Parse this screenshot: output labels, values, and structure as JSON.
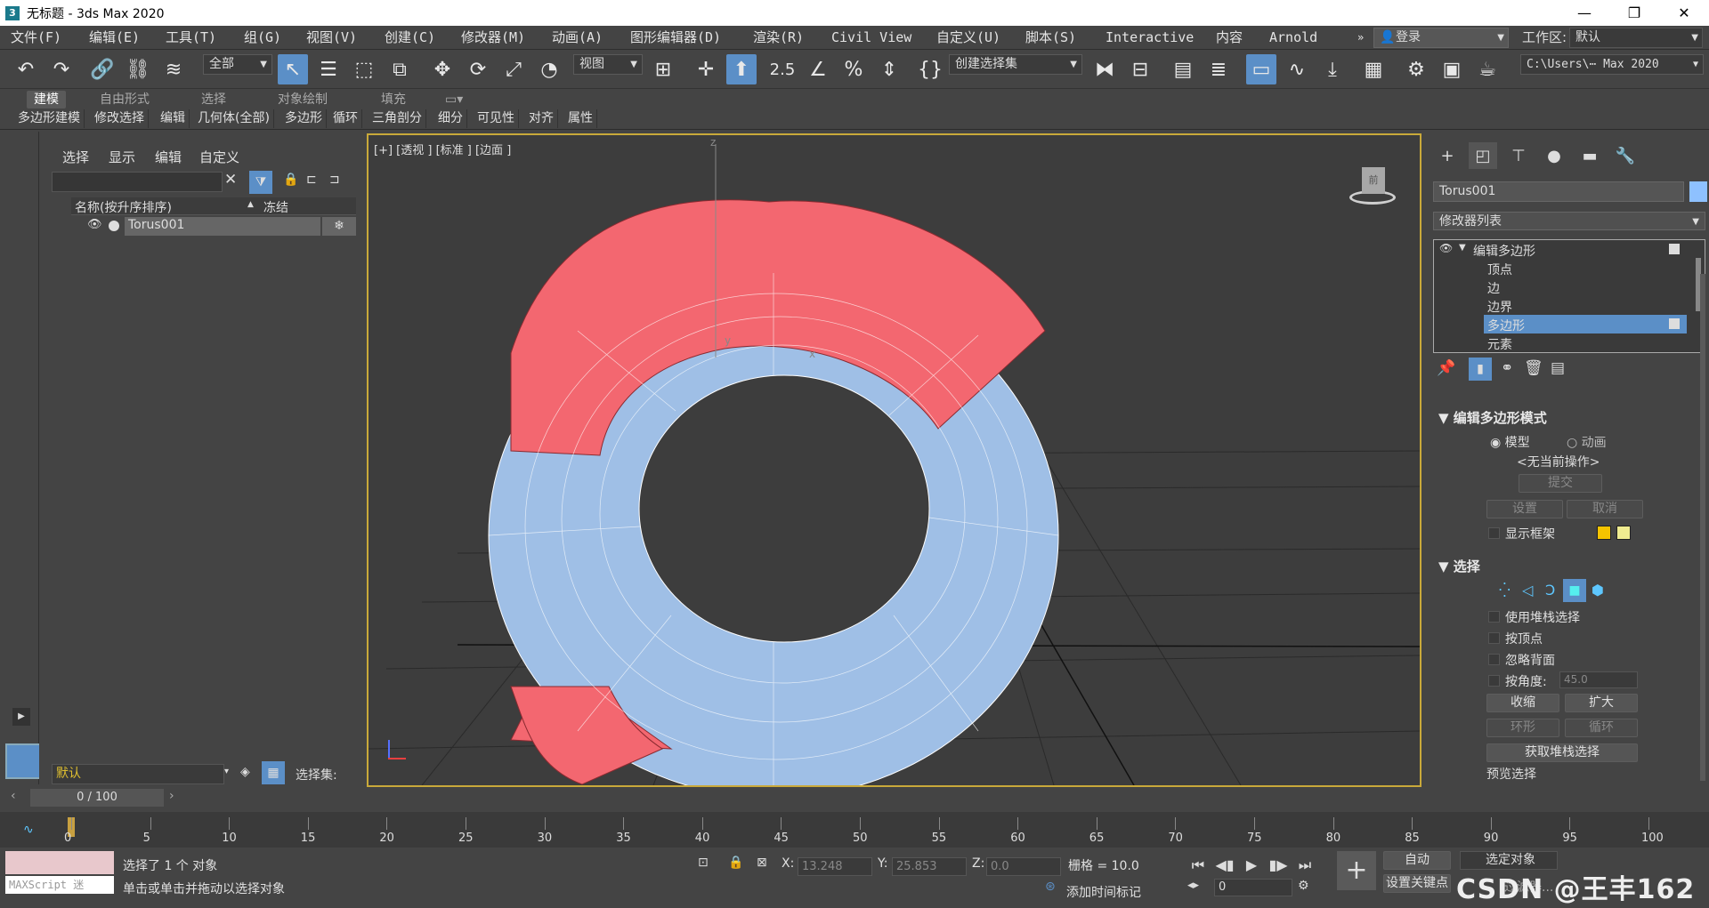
{
  "window": {
    "title": "无标题 - 3ds Max 2020",
    "minimize": "—",
    "restore": "❐",
    "close": "✕"
  },
  "menu": [
    "文件(F)",
    "编辑(E)",
    "工具(T)",
    "组(G)",
    "视图(V)",
    "创建(C)",
    "修改器(M)",
    "动画(A)",
    "图形编辑器(D)",
    "渲染(R)",
    "Civil View",
    "自定义(U)",
    "脚本(S)",
    "Interactive",
    "内容",
    "Arnold"
  ],
  "login": "登录",
  "workspace": {
    "label": "工作区:",
    "value": "默认"
  },
  "toolbar": {
    "selection_filter": "全部",
    "ref_coord": "视图",
    "named_sel": "创建选择集",
    "path": "C:\\Users\\⋯ Max 2020",
    "snap_angle": "2.5"
  },
  "ribbon": {
    "tabs": [
      "建模",
      "自由形式",
      "选择",
      "对象绘制",
      "填充"
    ],
    "subs": [
      "多边形建模",
      "修改选择",
      "编辑",
      "几何体(全部)",
      "多边形",
      "循环",
      "三角剖分",
      "细分",
      "可见性",
      "对齐",
      "属性"
    ]
  },
  "scene": {
    "menu": [
      "选择",
      "显示",
      "编辑",
      "自定义"
    ],
    "col_name": "名称(按升序排序)",
    "col_freeze": "冻结",
    "object": "Torus001",
    "layer": "默认",
    "selset": "选择集:"
  },
  "viewport": {
    "label": "[+] [透视 ] [标准 ] [边面 ]",
    "axis_z": "z",
    "axis_y": "y",
    "axis_x": "x",
    "viewcube": "前"
  },
  "cmd": {
    "object_name": "Torus001",
    "modlist": "修改器列表",
    "stack": [
      "编辑多边形",
      "顶点",
      "边",
      "边界",
      "多边形",
      "元素"
    ],
    "rollout1": "编辑多边形模式",
    "radio_model": "模型",
    "radio_anim": "动画",
    "no_op": "<无当前操作>",
    "commit": "提交",
    "settings": "设置",
    "cancel": "取消",
    "show_cage": "显示框架",
    "rollout2": "选择",
    "use_stack": "使用堆栈选择",
    "by_vertex": "按顶点",
    "ignore_back": "忽略背面",
    "by_angle": "按角度:",
    "angle_val": "45.0",
    "shrink": "收缩",
    "grow": "扩大",
    "ring": "环形",
    "loop": "循环",
    "get_stack": "获取堆栈选择",
    "preview": "预览选择"
  },
  "timeline": {
    "frame": "0 / 100",
    "ticks": [
      "0",
      "5",
      "10",
      "15",
      "20",
      "25",
      "30",
      "35",
      "40",
      "45",
      "50",
      "55",
      "60",
      "65",
      "70",
      "75",
      "80",
      "85",
      "90",
      "95",
      "100"
    ]
  },
  "status": {
    "maxscript": "MAXScript 迷",
    "selected": "选择了 1 个 对象",
    "hint": "单击或单击并拖动以选择对象",
    "x_label": "X:",
    "x": "13.248",
    "y_label": "Y:",
    "y": "25.853",
    "z_label": "Z:",
    "z": "0.0",
    "grid": "栅格 = 10.0",
    "add_tag": "添加时间标记",
    "auto": "自动",
    "set_key": "设置关键点",
    "sel_obj": "选定对象",
    "filter": "过滤器...",
    "frame_field": "0",
    "watermark": "CSDN @王丰162"
  },
  "colors": {
    "accent": "#5b8fc7",
    "selected_face": "#f36770",
    "mesh": "#9fbfe6",
    "viewport_border": "#c9a93a"
  }
}
